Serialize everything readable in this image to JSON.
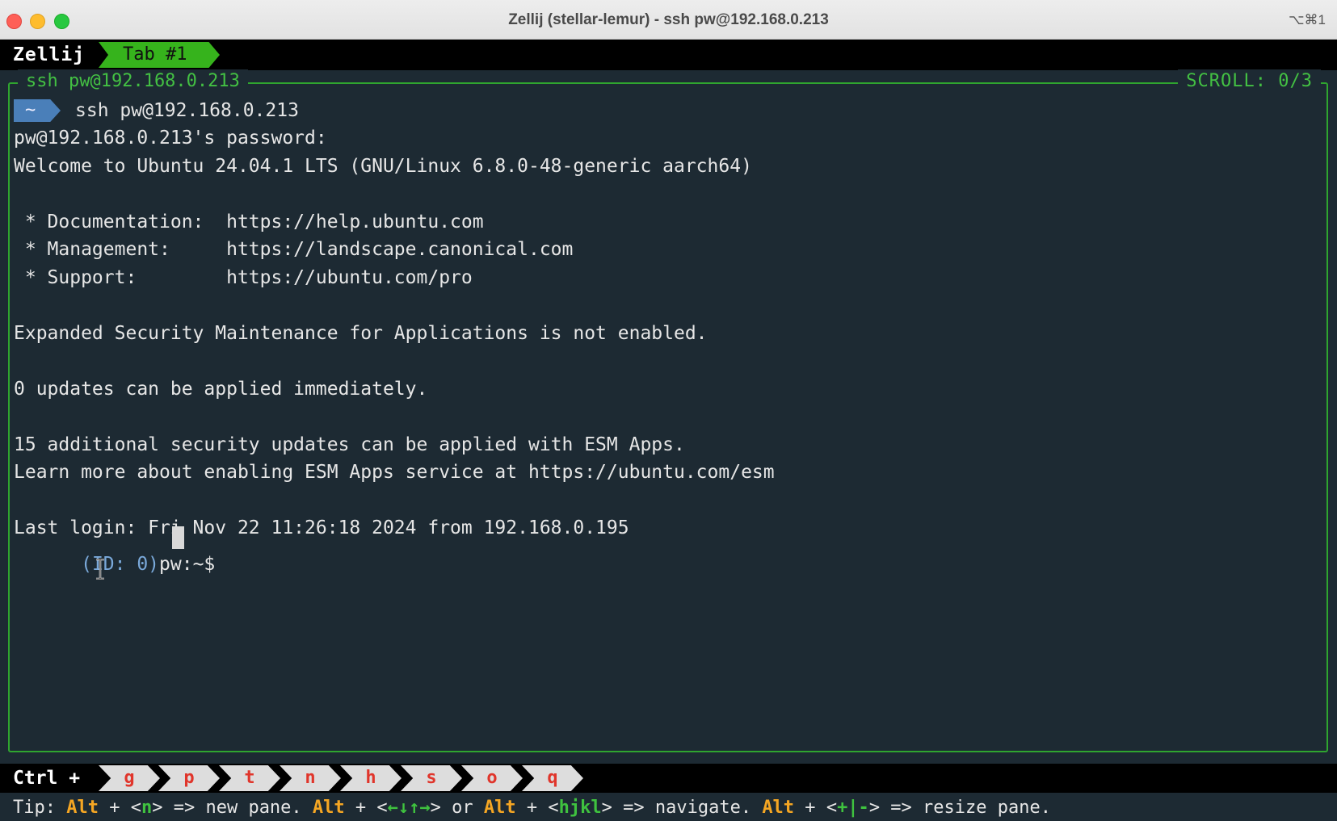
{
  "window": {
    "title": "Zellij (stellar-lemur) - ssh pw@192.168.0.213",
    "shortcut": "⌥⌘1"
  },
  "tabbar": {
    "app_name": "Zellij",
    "active_tab": "Tab #1"
  },
  "pane": {
    "title": "ssh pw@192.168.0.213",
    "scroll": "SCROLL:  0/3"
  },
  "terminal": {
    "prompt_dir": "~",
    "command": "ssh pw@192.168.0.213",
    "lines": [
      "pw@192.168.0.213's password:",
      "Welcome to Ubuntu 24.04.1 LTS (GNU/Linux 6.8.0-48-generic aarch64)",
      "",
      " * Documentation:  https://help.ubuntu.com",
      " * Management:     https://landscape.canonical.com",
      " * Support:        https://ubuntu.com/pro",
      "",
      "Expanded Security Maintenance for Applications is not enabled.",
      "",
      "0 updates can be applied immediately.",
      "",
      "15 additional security updates can be applied with ESM Apps.",
      "Learn more about enabling ESM Apps service at https://ubuntu.com/esm",
      "",
      "Last login: Fri Nov 22 11:26:18 2024 from 192.168.0.195"
    ],
    "final_prompt_id": "(ID: 0)",
    "final_prompt": "pw:~$"
  },
  "keybar": {
    "modifier": "Ctrl +",
    "keys": [
      "g",
      "p",
      "t",
      "n",
      "h",
      "s",
      "o",
      "q"
    ]
  },
  "tip": {
    "label": "Tip: ",
    "alt": "Alt",
    "plus": " + ",
    "k1_open": "<",
    "k1": "n",
    "k1_close": ">",
    "t1": " => new pane. ",
    "k2": "←↓↑→",
    "t2": " or ",
    "k3": "hjkl",
    "t3": " => navigate. ",
    "k4": "+|-",
    "t4": " => resize pane."
  }
}
